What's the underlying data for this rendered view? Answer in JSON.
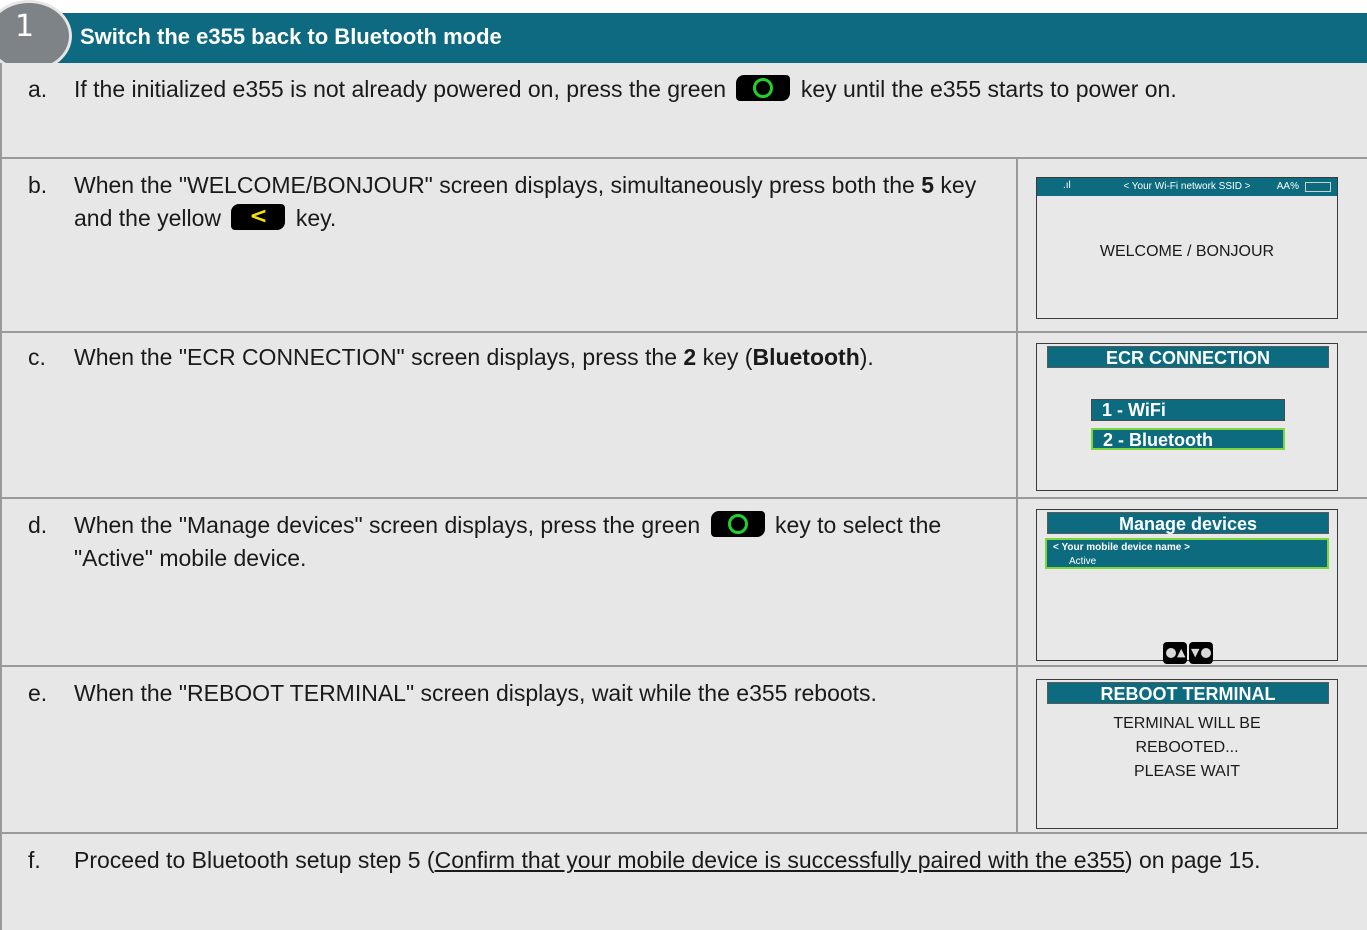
{
  "header": {
    "step_number": "1",
    "title": "Switch the e355 back to Bluetooth mode"
  },
  "rows": {
    "a": {
      "letter": "a.",
      "text_1": "If the initialized e355 is not already powered on, press the green",
      "text_2": "key until the e355 starts to power on."
    },
    "b": {
      "letter": "b.",
      "text_1": "When the \"WELCOME/BONJOUR\" screen displays, simultaneously press both the",
      "bold_1": "5",
      "text_2": "key and the yellow",
      "text_3": "key."
    },
    "c": {
      "letter": "c.",
      "text_1": "When the \"ECR CONNECTION\" screen displays, press the",
      "bold_1": "2",
      "text_2": "key (",
      "bold_2": "Bluetooth",
      "text_3": ")."
    },
    "d": {
      "letter": "d.",
      "text_1": "When the \"Manage devices\" screen displays, press the green",
      "text_2": "key to select the \"Active\" mobile device."
    },
    "e": {
      "letter": "e.",
      "text_1": "When the \"REBOOT TERMINAL\" screen displays, wait while the e355 reboots."
    },
    "f": {
      "letter": "f.",
      "text_1": "Proceed to Bluetooth setup step 5 (",
      "link": "Confirm that your mobile device is successfully paired with the e355",
      "text_2": ") on page 15."
    }
  },
  "screens": {
    "welcome": {
      "ssid": "< Your Wi-Fi network SSID >",
      "battery": "AA%",
      "message": "WELCOME / BONJOUR"
    },
    "ecr": {
      "title": "ECR CONNECTION",
      "option_1": "1 - WiFi",
      "option_2": "2 - Bluetooth"
    },
    "manage": {
      "title": "Manage devices",
      "device_name": "< Your mobile device name >",
      "device_status": "Active"
    },
    "reboot": {
      "title": "REBOOT TERMINAL",
      "line_1": "TERMINAL WILL BE",
      "line_2": "REBOOTED...",
      "line_3": "PLEASE WAIT"
    }
  },
  "colors": {
    "header_bg": "#0e6a80",
    "step_circle": "#7d8386",
    "row_bg": "#e7e7e7",
    "green_key": "#22d02a",
    "yellow_key": "#f5e400",
    "highlight": "#7dd63a"
  },
  "icons": {
    "green_key": "green-circle-key-icon",
    "yellow_key": "yellow-back-key-icon",
    "signal": "signal-bars-icon",
    "battery": "battery-icon",
    "nav_up": "nav-up-key-icon",
    "nav_down": "nav-down-key-icon"
  }
}
